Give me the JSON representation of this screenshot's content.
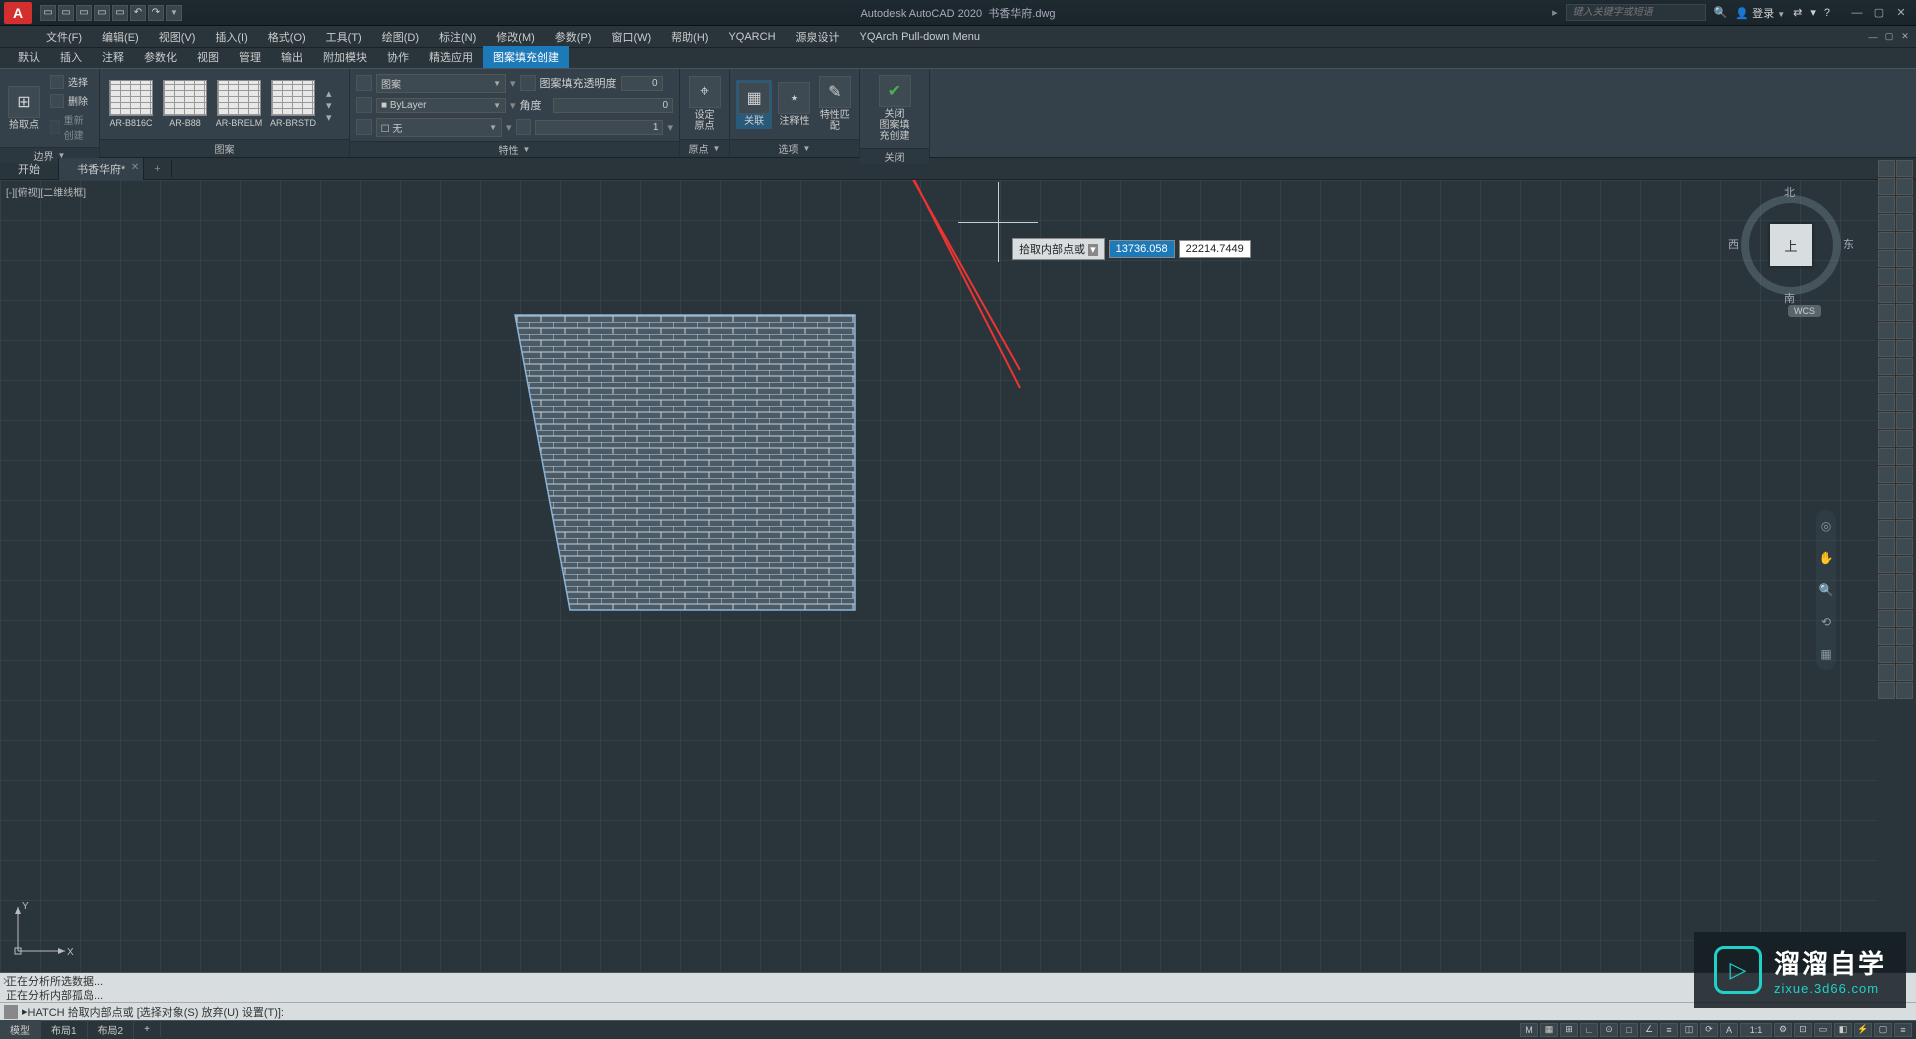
{
  "app": {
    "title_prefix": "Autodesk AutoCAD 2020",
    "filename": "书香华府.dwg",
    "logo": "A"
  },
  "qat_icons": [
    "new",
    "open",
    "save",
    "saveas",
    "plot",
    "undo",
    "redo",
    "more"
  ],
  "search": {
    "placeholder": "键入关键字或短语"
  },
  "title_right": {
    "login": "登录",
    "help_glyph": "?"
  },
  "menus": [
    "文件(F)",
    "编辑(E)",
    "视图(V)",
    "插入(I)",
    "格式(O)",
    "工具(T)",
    "绘图(D)",
    "标注(N)",
    "修改(M)",
    "参数(P)",
    "窗口(W)",
    "帮助(H)",
    "YQARCH",
    "源泉设计",
    "YQArch Pull-down Menu"
  ],
  "ribtabs": [
    "默认",
    "插入",
    "注释",
    "参数化",
    "视图",
    "管理",
    "输出",
    "附加模块",
    "协作",
    "精选应用",
    "图案填充创建"
  ],
  "ribtab_active": 10,
  "ribbon": {
    "boundary": {
      "pick": "拾取点",
      "select": "选择",
      "delete": "删除",
      "recreate": "重新创建",
      "title": "边界"
    },
    "pattern": {
      "swatches": [
        "AR-B816C",
        "AR-B88",
        "AR-BRELM",
        "AR-BRSTD"
      ],
      "title": "图案"
    },
    "props": {
      "type": "图案",
      "color": "ByLayer",
      "none": "无",
      "none_val": "1",
      "trans_label": "图案填充透明度",
      "trans_val": "0",
      "angle_label": "角度",
      "angle_val": "0",
      "scale_val": "1",
      "title": "特性"
    },
    "origin": {
      "label1": "设定",
      "label2": "原点",
      "title": "原点"
    },
    "options": {
      "assoc": "关联",
      "annot": "注释性",
      "match": "特性匹配",
      "title": "选项"
    },
    "close": {
      "label1": "关闭",
      "label2": "图案填充创建",
      "title": "关闭"
    }
  },
  "filetabs": {
    "start": "开始",
    "doc": "书香华府*",
    "plus": "+"
  },
  "viewport": {
    "label": "[-][俯视][二维线框]"
  },
  "viewcube": {
    "top": "上",
    "n": "北",
    "s": "南",
    "e": "东",
    "w": "西",
    "wcs": "WCS"
  },
  "ucs": {
    "x": "X",
    "y": "Y"
  },
  "dynamic_input": {
    "prompt": "拾取内部点或",
    "x": "13736.058",
    "y": "22214.7449"
  },
  "cmd": {
    "hist1": "正在分析所选数据...",
    "hist2": "正在分析内部孤岛...",
    "line": "HATCH 拾取内部点或 [选择对象(S) 放弃(U) 设置(T)]:"
  },
  "status": {
    "tabs": [
      "模型",
      "布局1",
      "布局2",
      "+"
    ],
    "active": 0,
    "scale": "1:1"
  },
  "watermark": {
    "brand": "溜溜自学",
    "url": "zixue.3d66.com",
    "play": "▷"
  }
}
